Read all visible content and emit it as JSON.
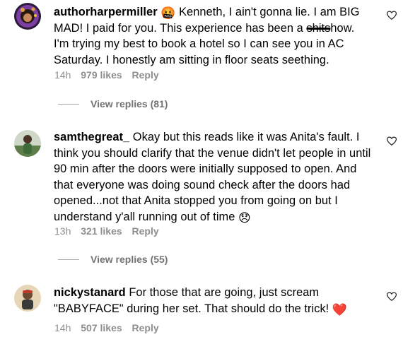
{
  "comments": [
    {
      "username": "authorharpermiller",
      "text_pre": "Kenneth, I ain't gonna lie. I am BIG MAD! I paid for you. This experience has been a ",
      "text_strike": "shits",
      "text_post": "how. I'm trying my best to book a hotel so I can see you in AC Saturday. I honestly am sitting in floor seats seething.",
      "emoji_lead": "🤬",
      "time": "14h",
      "likes": "979 likes",
      "reply": "Reply",
      "view_replies": "View replies (81)"
    },
    {
      "username": "samthegreat_",
      "text": "Okay but this reads like it was Anita's fault. I think you should clarify that the venue didn't let people in until 90 min after the doors were initially supposed to open. And that everyone was doing sound check after the doors had opened...not that Anita stopped you from going on but I understand y'all running out of time",
      "emoji_tail": "😞",
      "time": "13h",
      "likes": "321 likes",
      "reply": "Reply",
      "view_replies": "View replies (55)"
    },
    {
      "username": "nickystanard",
      "text": "For those that are going, just scream \"BABYFACE\" during her set. That should do the trick!",
      "emoji_tail": "❤️",
      "time": "14h",
      "likes": "507 likes",
      "reply": "Reply"
    }
  ],
  "icons": {
    "like": "heart-outline-icon"
  }
}
